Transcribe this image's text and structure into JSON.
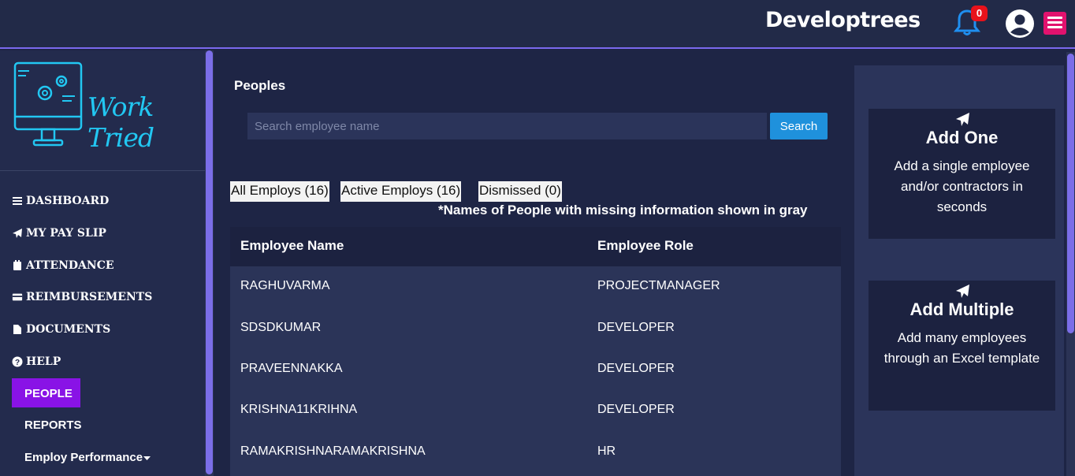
{
  "header": {
    "brand": "Developtrees",
    "notification_count": "0"
  },
  "sidebar": {
    "logo_text": "Work Tried",
    "items": [
      {
        "label": "DASHBOARD",
        "icon": "bars-icon"
      },
      {
        "label": "MY PAY SLIP",
        "icon": "paper-plane-icon"
      },
      {
        "label": "ATTENDANCE",
        "icon": "calendar-icon"
      },
      {
        "label": "REIMBURSEMENTS",
        "icon": "credit-card-icon"
      },
      {
        "label": "DOCUMENTS",
        "icon": "file-icon"
      },
      {
        "label": "HELP",
        "icon": "question-circle-icon"
      },
      {
        "label": "PEOPLE",
        "active": true
      },
      {
        "label": "REPORTS"
      },
      {
        "label": "Employ Performance",
        "icon": "caret-down-icon"
      }
    ]
  },
  "main": {
    "title": "Peoples",
    "search": {
      "placeholder": "Search employee name",
      "button": "Search"
    },
    "filters": [
      "All Employs (16)",
      "Active Employs (16)",
      "Dismissed (0)"
    ],
    "note": "*Names of People with missing information shown in gray",
    "table": {
      "headers": [
        "Employee Name",
        "Employee Role"
      ],
      "rows": [
        [
          "RAGHUVARMA",
          "PROJECTMANAGER"
        ],
        [
          "SDSDKUMAR",
          "DEVELOPER"
        ],
        [
          "PRAVEENNAKKA",
          "DEVELOPER"
        ],
        [
          "KRISHNA11KRIHNA",
          "DEVELOPER"
        ],
        [
          "RAMAKRISHNARAMAKRISHNA",
          "HR"
        ]
      ]
    }
  },
  "right_panel": {
    "cards": [
      {
        "title": "Add One",
        "description": "Add a single employee and/or contractors in seconds"
      },
      {
        "title": "Add Multiple",
        "description": "Add many employees through an Excel template"
      }
    ]
  },
  "colors": {
    "background": "#1e2545",
    "active_nav": "#8913e6",
    "accent": "#1f91dc",
    "scrollbar": "#7b6ee8",
    "menu_button": "#e2126e",
    "logo": "#22c7f2"
  }
}
